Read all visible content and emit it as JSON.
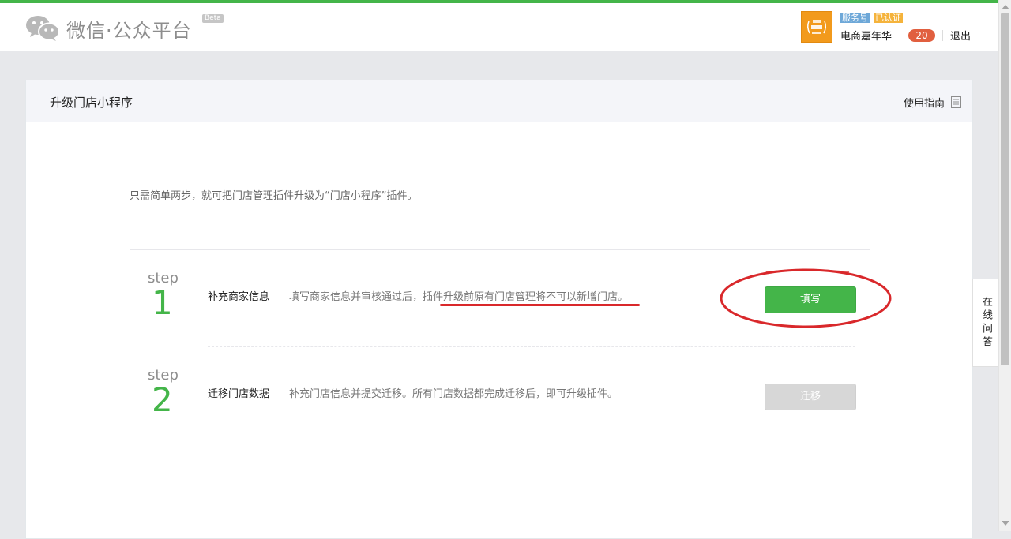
{
  "header": {
    "brand": "微信·公众平台",
    "beta": "Beta",
    "tags": [
      "服务号",
      "已认证"
    ],
    "account_name": "电商嘉年华",
    "message_count": "20",
    "logout": "退出"
  },
  "panel": {
    "title": "升级门店小程序",
    "guide": "使用指南",
    "intro": "只需简单两步，就可把门店管理插件升级为“门店小程序”插件。",
    "steps": [
      {
        "word": "step",
        "number": "1",
        "name": "补充商家信息",
        "desc": "填写商家信息并审核通过后，插件升级前原有门店管理将不可以新增门店。",
        "button": "填写",
        "enabled": true
      },
      {
        "word": "step",
        "number": "2",
        "name": "迁移门店数据",
        "desc": "补充门店信息并提交迁移。所有门店数据都完成迁移后，即可升级插件。",
        "button": "迁移",
        "enabled": false
      }
    ]
  },
  "side_tab": "在线问答",
  "colors": {
    "accent": "#44b549",
    "annotation": "#d9282b",
    "count_badge": "#e15f3f"
  },
  "icons": [
    "wechat-logo-icon",
    "document-icon"
  ]
}
